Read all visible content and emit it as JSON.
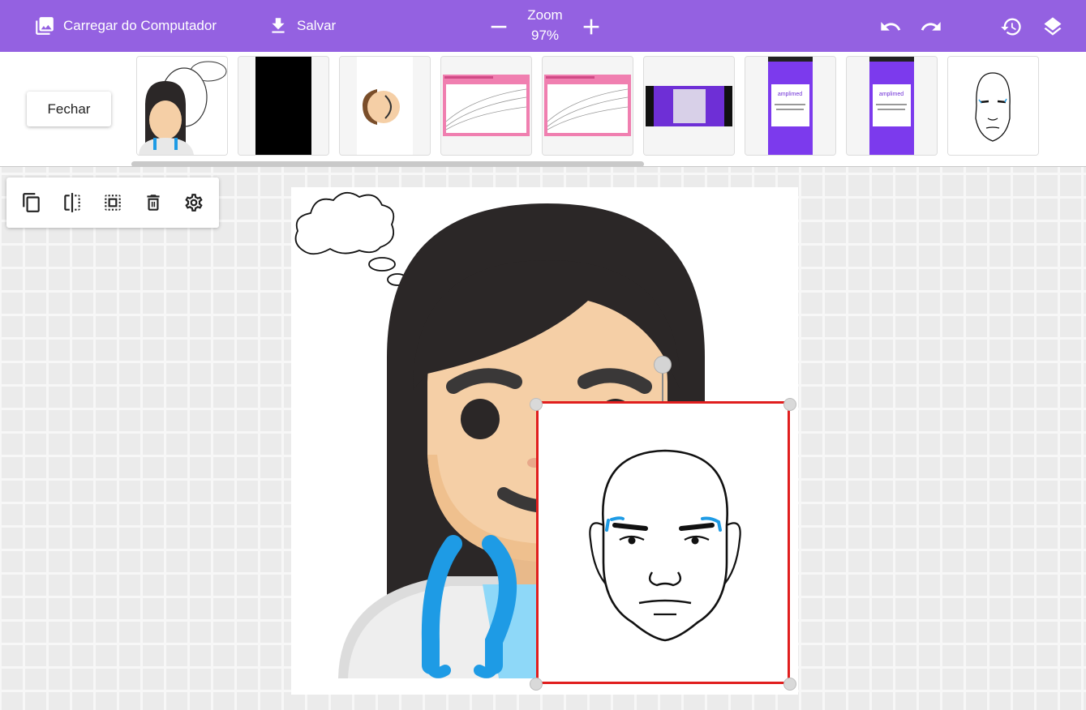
{
  "topbar": {
    "upload_label": "Carregar do Computador",
    "save_label": "Salvar",
    "zoom_label": "Zoom",
    "zoom_value": "97%",
    "icons": [
      "image-icon",
      "download-icon",
      "zoom-out-icon",
      "zoom-in-icon",
      "undo-icon",
      "redo-icon",
      "history-icon",
      "layers-icon"
    ]
  },
  "thumbstrip": {
    "close_label": "Fechar",
    "thumbnails": [
      {
        "name": "thumb-doctor-thinking"
      },
      {
        "name": "thumb-black-rectangle"
      },
      {
        "name": "thumb-face-profile"
      },
      {
        "name": "thumb-growth-chart-1"
      },
      {
        "name": "thumb-growth-chart-2"
      },
      {
        "name": "thumb-amplimed-landscape"
      },
      {
        "name": "thumb-amplimed-phone-1",
        "brand": "amplimed"
      },
      {
        "name": "thumb-amplimed-phone-2",
        "brand": "amplimed"
      },
      {
        "name": "thumb-face-drawing"
      }
    ]
  },
  "toolbar": {
    "tools": [
      "duplicate-icon",
      "flip-icon",
      "crop-icon",
      "delete-icon",
      "settings-icon"
    ]
  },
  "colors": {
    "brand_purple": "#9461e1",
    "selection_red": "#e01e1e",
    "stethoscope_blue": "#1e9be5",
    "hair": "#2b2727",
    "skin": "#f5cfa6"
  }
}
